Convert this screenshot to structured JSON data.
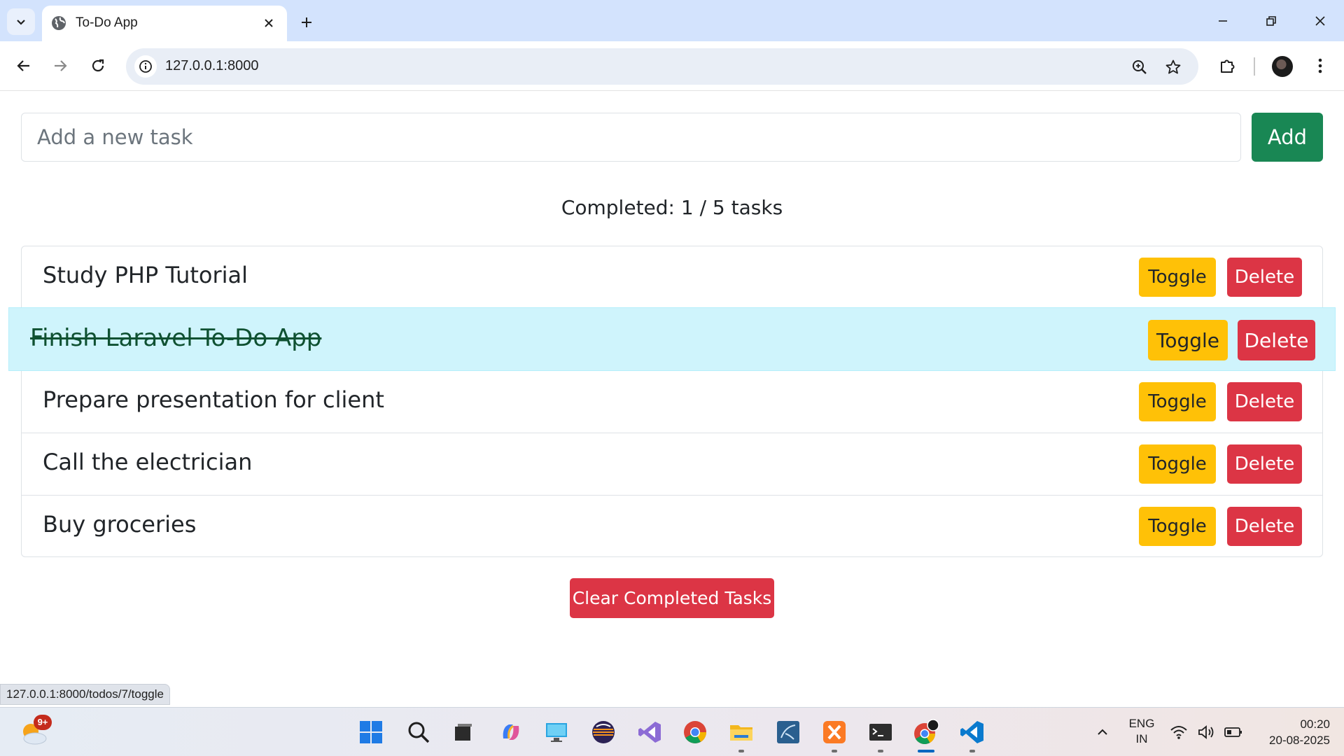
{
  "browser": {
    "tab_title": "To-Do App",
    "url": "127.0.0.1:8000",
    "status_link": "127.0.0.1:8000/todos/7/toggle"
  },
  "form": {
    "placeholder": "Add a new task",
    "value": "",
    "add_label": "Add"
  },
  "summary": {
    "text": "Completed: 1 / 5 tasks"
  },
  "tasks": [
    {
      "title": "Study PHP Tutorial",
      "completed": false
    },
    {
      "title": "Finish Laravel To-Do App",
      "completed": true
    },
    {
      "title": "Prepare presentation for client",
      "completed": false
    },
    {
      "title": "Call the electrician",
      "completed": false
    },
    {
      "title": "Buy groceries",
      "completed": false
    }
  ],
  "buttons": {
    "toggle_label": "Toggle",
    "delete_label": "Delete",
    "clear_completed_label": "Clear Completed Tasks"
  },
  "colors": {
    "add": "#198754",
    "toggle": "#ffc107",
    "delete": "#dc3545",
    "completed_row_bg": "#cff4fc"
  },
  "taskbar": {
    "weather_badge": "9+",
    "language_line1": "ENG",
    "language_line2": "IN",
    "time": "00:20",
    "date": "20-08-2025",
    "apps": [
      "start-icon",
      "search-icon",
      "task-view-icon",
      "copilot-icon",
      "remote-desktop-icon",
      "eclipse-icon",
      "visual-studio-icon",
      "chrome-icon",
      "file-explorer-icon",
      "mysql-workbench-icon",
      "xampp-icon",
      "terminal-icon",
      "chrome-profile-icon",
      "vscode-icon"
    ]
  }
}
